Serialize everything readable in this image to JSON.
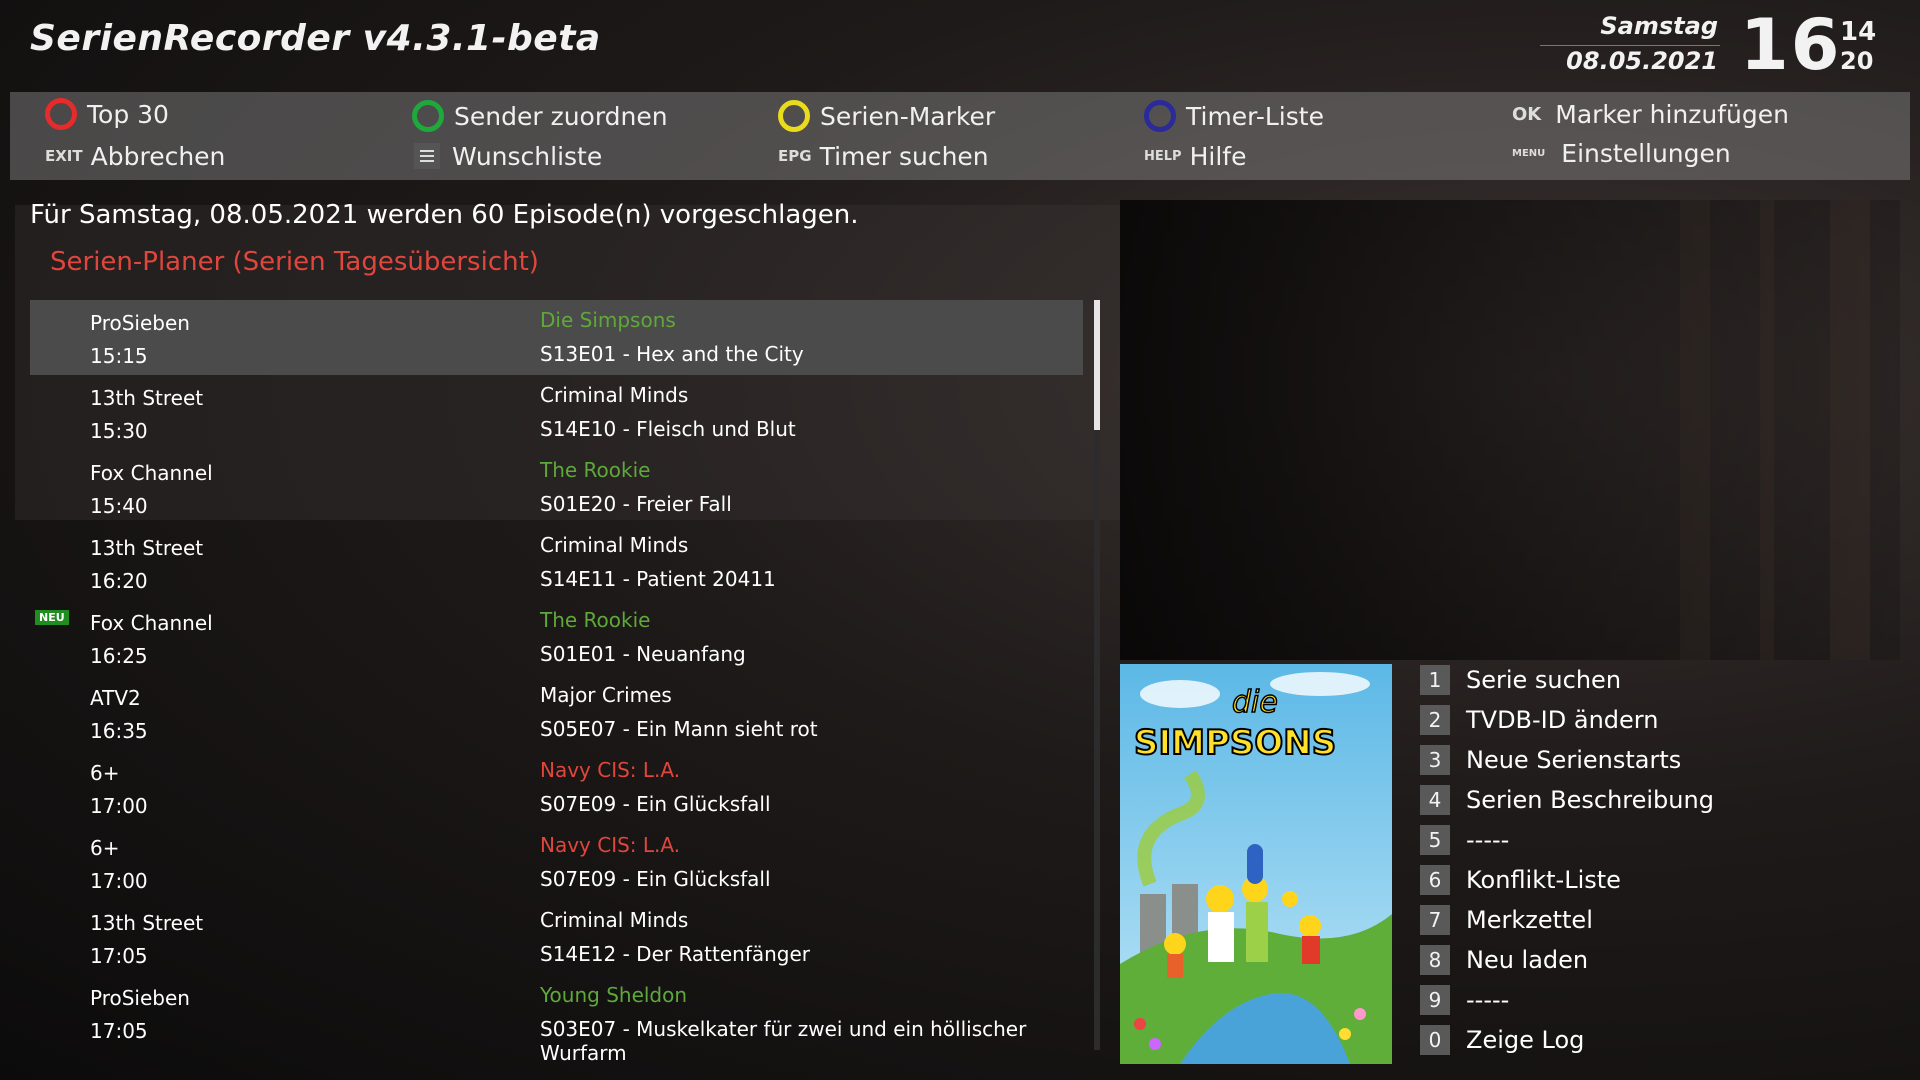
{
  "header": {
    "title": "SerienRecorder v4.3.1-beta",
    "day": "Samstag",
    "date": "08.05.2021",
    "clock_hour": "16",
    "clock_min": "14",
    "clock_sec": "20"
  },
  "buttons": {
    "red": {
      "label": "Top 30",
      "color": "#e52b2b"
    },
    "green": {
      "label": "Sender zuordnen",
      "color": "#1fa83c"
    },
    "yellow": {
      "label": "Serien-Marker",
      "color": "#e8dc1c"
    },
    "blue": {
      "label": "Timer-Liste",
      "color": "#2a2a9a"
    },
    "ok": {
      "key": "OK",
      "label": "Marker hinzufügen"
    },
    "exit": {
      "key": "EXIT",
      "label": "Abbrechen"
    },
    "wish": {
      "label": "Wunschliste"
    },
    "epg": {
      "key": "EPG",
      "label": "Timer suchen"
    },
    "help": {
      "key": "HELP",
      "label": "Hilfe"
    },
    "menu": {
      "key": "MENU",
      "label": "Einstellungen"
    }
  },
  "info": "Für Samstag, 08.05.2021 werden 60 Episode(n) vorgeschlagen.",
  "planer_title": "Serien-Planer (Serien Tagesübersicht)",
  "colors": {
    "green_series": "#5fa83a",
    "red_series": "#e0463c",
    "white_series": "#ffffff"
  },
  "list": [
    {
      "channel": "ProSieben",
      "time": "15:15",
      "series": "Die Simpsons",
      "episode": "S13E01 - Hex and the City",
      "color": "#5fa83a",
      "neu": ""
    },
    {
      "channel": "13th Street",
      "time": "15:30",
      "series": "Criminal Minds",
      "episode": "S14E10 - Fleisch und Blut",
      "color": "#ffffff",
      "neu": ""
    },
    {
      "channel": "Fox Channel",
      "time": "15:40",
      "series": "The Rookie",
      "episode": "S01E20 - Freier Fall",
      "color": "#5fa83a",
      "neu": ""
    },
    {
      "channel": "13th Street",
      "time": "16:20",
      "series": "Criminal Minds",
      "episode": "S14E11 - Patient 20411",
      "color": "#ffffff",
      "neu": ""
    },
    {
      "channel": "Fox Channel",
      "time": "16:25",
      "series": "The Rookie",
      "episode": "S01E01 - Neuanfang",
      "color": "#5fa83a",
      "neu": "NEU"
    },
    {
      "channel": "ATV2",
      "time": "16:35",
      "series": "Major Crimes",
      "episode": "S05E07 - Ein Mann sieht rot",
      "color": "#ffffff",
      "neu": ""
    },
    {
      "channel": "6+",
      "time": "17:00",
      "series": "Navy CIS: L.A.",
      "episode": "S07E09 - Ein Glücksfall",
      "color": "#e0463c",
      "neu": ""
    },
    {
      "channel": "6+",
      "time": "17:00",
      "series": "Navy CIS: L.A.",
      "episode": "S07E09 - Ein Glücksfall",
      "color": "#e0463c",
      "neu": ""
    },
    {
      "channel": "13th Street",
      "time": "17:05",
      "series": "Criminal Minds",
      "episode": "S14E12 - Der Rattenfänger",
      "color": "#ffffff",
      "neu": ""
    },
    {
      "channel": "ProSieben",
      "time": "17:05",
      "series": "Young Sheldon",
      "episode": "S03E07 - Muskelkater für zwei und ein höllischer Wurfarm",
      "color": "#5fa83a",
      "neu": ""
    }
  ],
  "poster": {
    "text1": "die",
    "text2": "SIMPSONS"
  },
  "menu": [
    {
      "num": "1",
      "label": "Serie suchen"
    },
    {
      "num": "2",
      "label": "TVDB-ID ändern"
    },
    {
      "num": "3",
      "label": "Neue Serienstarts"
    },
    {
      "num": "4",
      "label": "Serien Beschreibung"
    },
    {
      "num": "5",
      "label": "-----"
    },
    {
      "num": "6",
      "label": "Konflikt-Liste"
    },
    {
      "num": "7",
      "label": "Merkzettel"
    },
    {
      "num": "8",
      "label": "Neu laden"
    },
    {
      "num": "9",
      "label": "-----"
    },
    {
      "num": "0",
      "label": "Zeige Log"
    }
  ]
}
